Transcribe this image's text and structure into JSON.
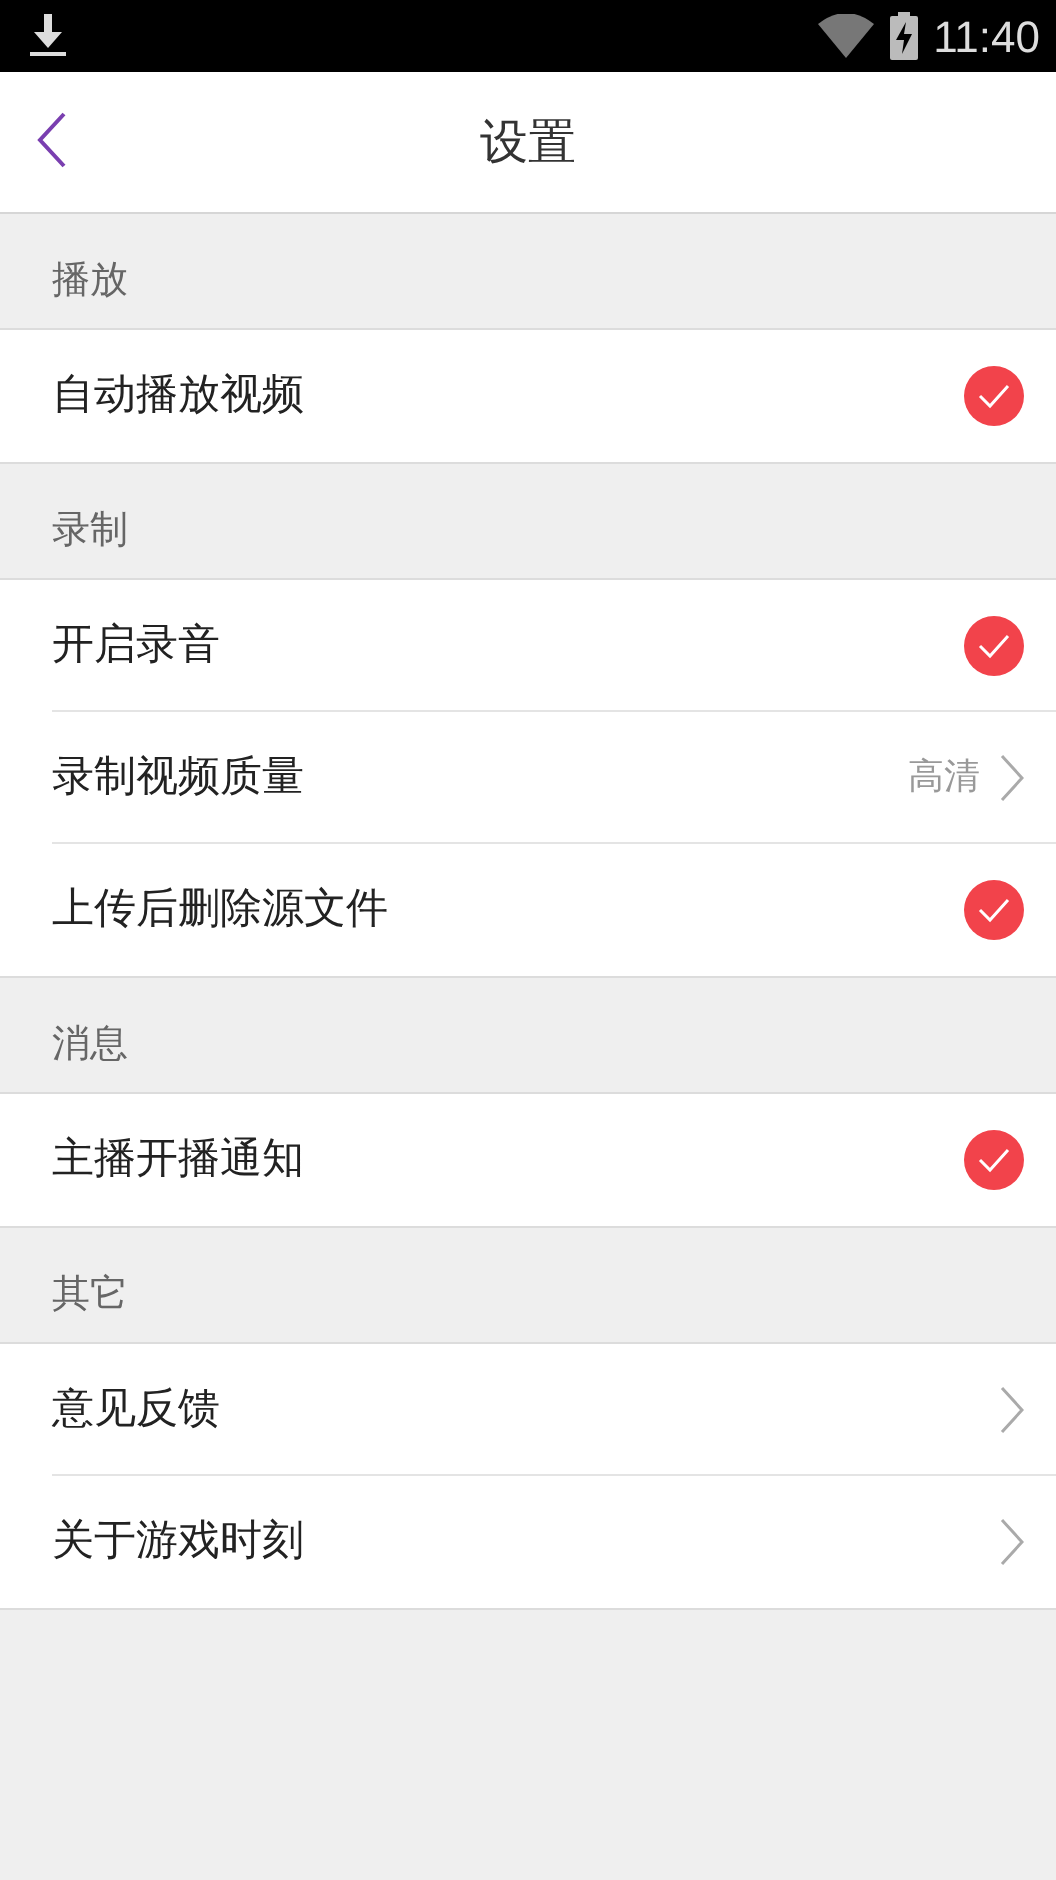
{
  "status_bar": {
    "time": "11:40"
  },
  "header": {
    "title": "设置"
  },
  "sections": [
    {
      "title": "播放",
      "items": [
        {
          "kind": "toggle",
          "label": "自动播放视频",
          "checked": true
        }
      ]
    },
    {
      "title": "录制",
      "items": [
        {
          "kind": "toggle",
          "label": "开启录音",
          "checked": true
        },
        {
          "kind": "link",
          "label": "录制视频质量",
          "value": "高清"
        },
        {
          "kind": "toggle",
          "label": "上传后删除源文件",
          "checked": true
        }
      ]
    },
    {
      "title": "消息",
      "items": [
        {
          "kind": "toggle",
          "label": "主播开播通知",
          "checked": true
        }
      ]
    },
    {
      "title": "其它",
      "items": [
        {
          "kind": "link",
          "label": "意见反馈"
        },
        {
          "kind": "link",
          "label": "关于游戏时刻"
        }
      ]
    }
  ]
}
